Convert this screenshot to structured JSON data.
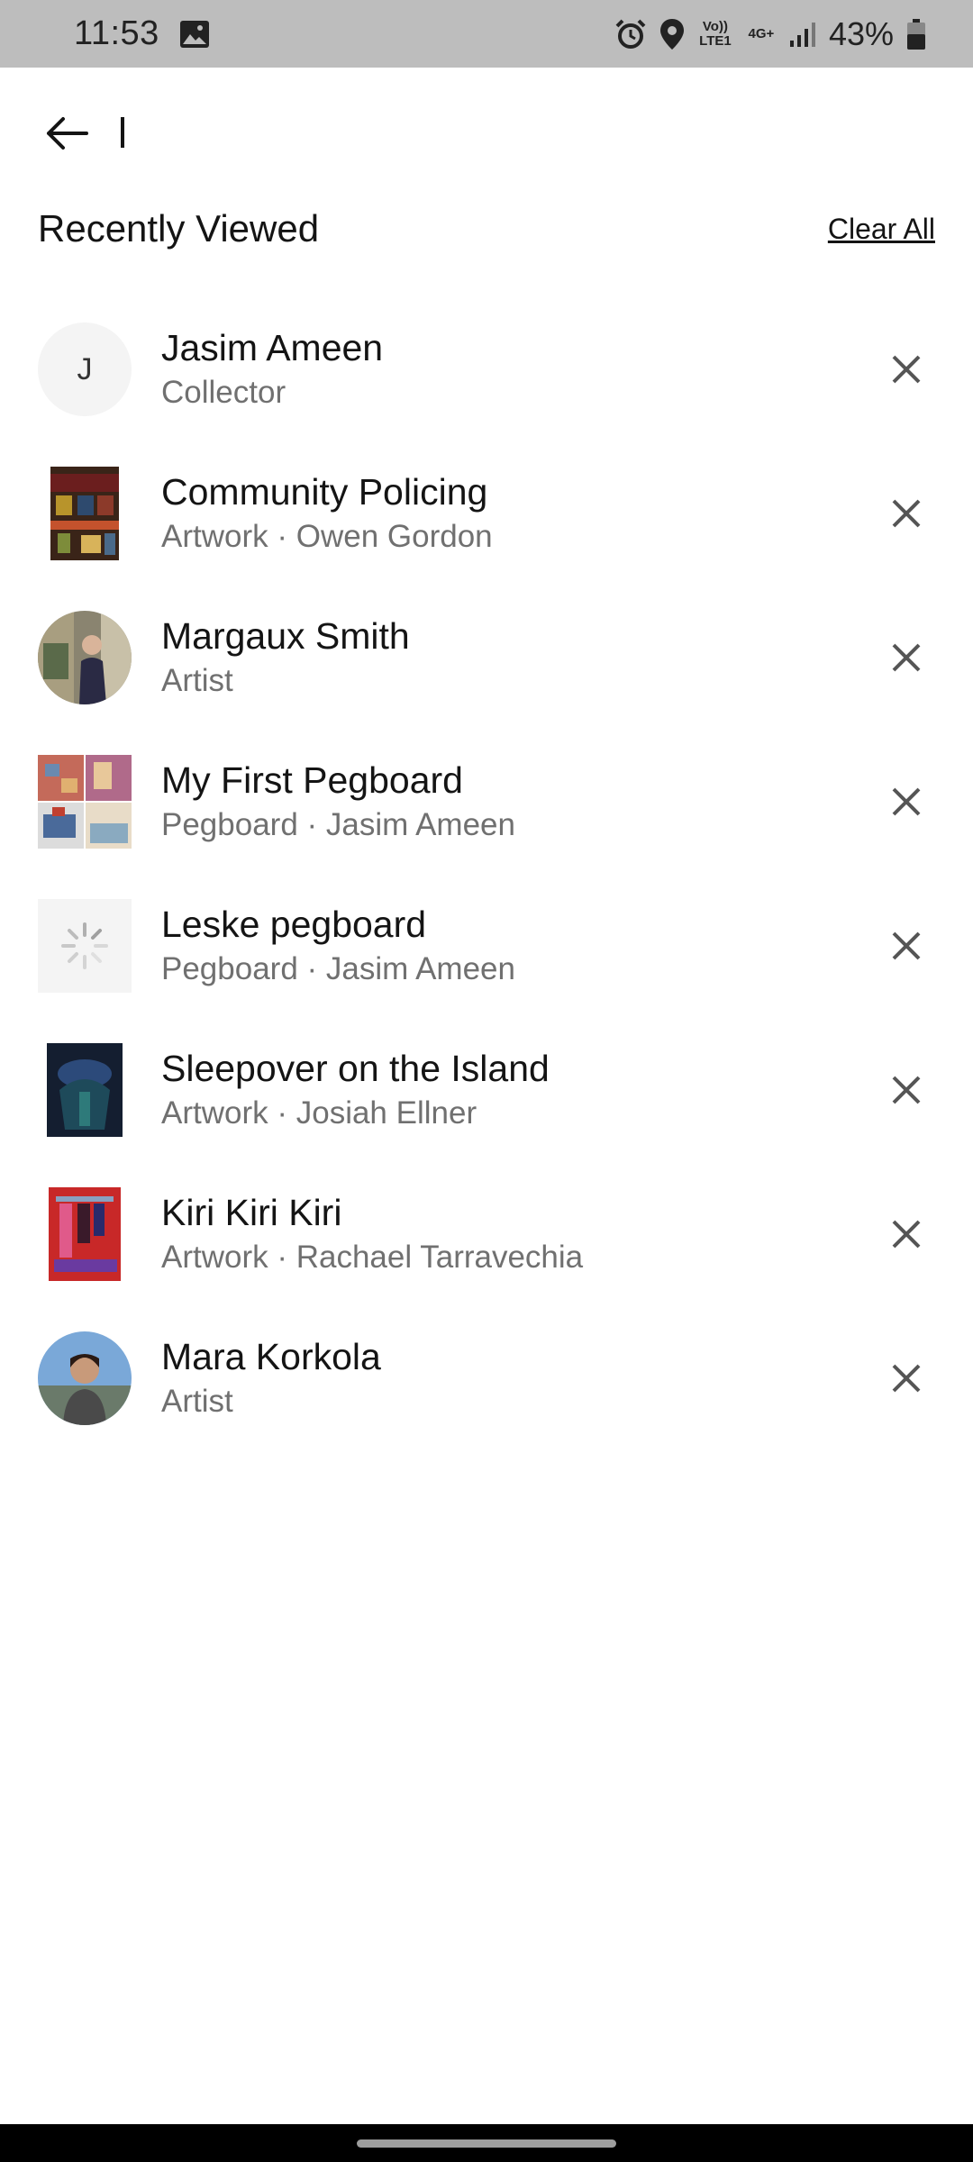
{
  "status_bar": {
    "time": "11:53",
    "network_volte": "Vo)) LTE1",
    "network_type": "4G+",
    "battery": "43%",
    "icons": [
      "gallery-icon",
      "alarm-icon",
      "location-icon",
      "signal-icon",
      "battery-icon"
    ]
  },
  "search": {
    "value": "",
    "back_icon": "arrow-left-icon"
  },
  "recent": {
    "title": "Recently Viewed",
    "clear_label": "Clear All",
    "items": [
      {
        "title": "Jasim Ameen",
        "subtitle": "Collector",
        "thumb": "avatar-initial",
        "initial": "J"
      },
      {
        "title": "Community Policing",
        "subtitle": "Artwork · Owen Gordon",
        "thumb": "artwork-image"
      },
      {
        "title": "Margaux Smith",
        "subtitle": "Artist",
        "thumb": "avatar-photo"
      },
      {
        "title": "My First Pegboard",
        "subtitle": "Pegboard · Jasim Ameen",
        "thumb": "pegboard-collage"
      },
      {
        "title": "Leske pegboard",
        "subtitle": "Pegboard · Jasim Ameen",
        "thumb": "loading-spinner"
      },
      {
        "title": "Sleepover on the Island",
        "subtitle": "Artwork · Josiah Ellner",
        "thumb": "artwork-image"
      },
      {
        "title": "Kiri Kiri Kiri",
        "subtitle": "Artwork · Rachael Tarravechia",
        "thumb": "artwork-image"
      },
      {
        "title": "Mara Korkola",
        "subtitle": "Artist",
        "thumb": "avatar-photo"
      }
    ]
  },
  "colors": {
    "status_bar_bg": "#bdbdbd",
    "text_primary": "#141414",
    "text_secondary": "#707070",
    "nav_bar_bg": "#000000"
  }
}
